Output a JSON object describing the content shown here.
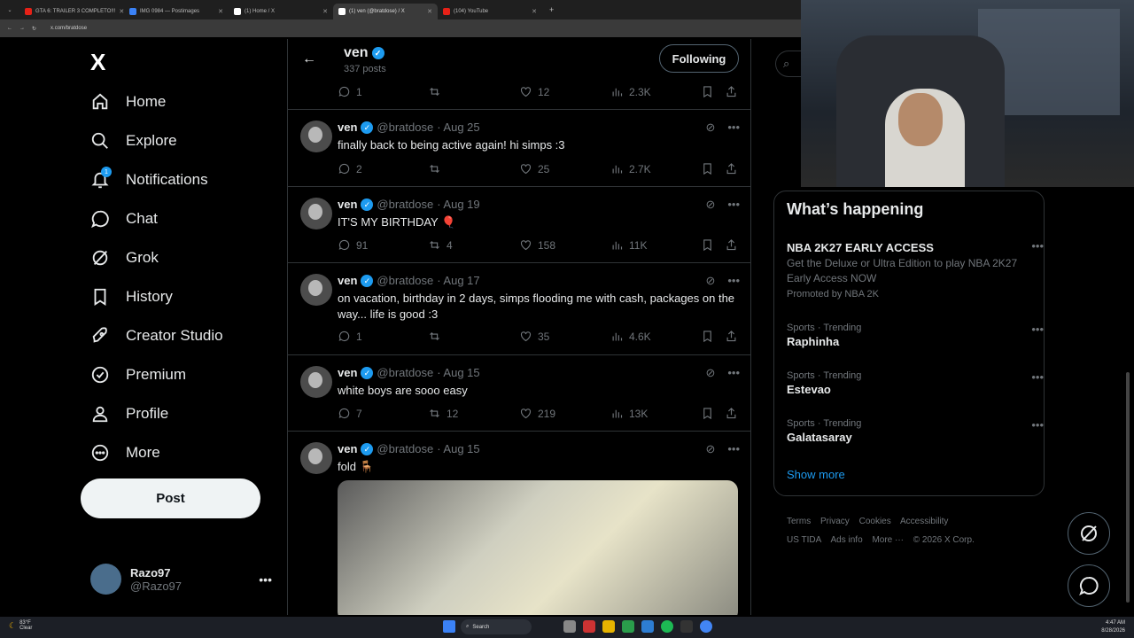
{
  "browser": {
    "tabs": [
      {
        "label": "GTA 6: TRAILER 3 COMPLETO!!!",
        "color": "#e62117",
        "active": false
      },
      {
        "label": "IMG 0984 — Postimages",
        "color": "#3b82f6",
        "active": false
      },
      {
        "label": "(1) Home / X",
        "color": "#ffffff",
        "active": false
      },
      {
        "label": "(1) ven (@bratdose) / X",
        "color": "#ffffff",
        "active": true
      },
      {
        "label": "(104) YouTube",
        "color": "#e62117",
        "active": false
      }
    ],
    "url": "x.com/bratdose"
  },
  "sidebar": {
    "logo": "X",
    "items": [
      {
        "label": "Home",
        "icon": "home-icon"
      },
      {
        "label": "Explore",
        "icon": "search-icon"
      },
      {
        "label": "Notifications",
        "icon": "bell-icon",
        "badge": "1"
      },
      {
        "label": "Chat",
        "icon": "chat-icon"
      },
      {
        "label": "Grok",
        "icon": "grok-icon"
      },
      {
        "label": "History",
        "icon": "bookmark-icon"
      },
      {
        "label": "Creator Studio",
        "icon": "rocket-icon"
      },
      {
        "label": "Premium",
        "icon": "verified-badge-icon"
      },
      {
        "label": "Profile",
        "icon": "person-icon"
      },
      {
        "label": "More",
        "icon": "more-circle-icon"
      }
    ],
    "post_label": "Post",
    "user": {
      "name": "Razo97",
      "handle": "@Razo97"
    }
  },
  "profile_header": {
    "name": "ven",
    "post_count": "337 posts",
    "follow_label": "Following"
  },
  "tweets": [
    {
      "name": "",
      "handle": "",
      "date": "",
      "text": "",
      "replies": "1",
      "reposts": "",
      "likes": "12",
      "views": "2.3K"
    },
    {
      "name": "ven",
      "handle": "@bratdose",
      "date": "· Aug 25",
      "text": "finally back to being active again! hi simps :3",
      "replies": "2",
      "reposts": "",
      "likes": "25",
      "views": "2.7K"
    },
    {
      "name": "ven",
      "handle": "@bratdose",
      "date": "· Aug 19",
      "text": "IT'S MY BIRTHDAY 🎈",
      "replies": "91",
      "reposts": "4",
      "likes": "158",
      "views": "11K"
    },
    {
      "name": "ven",
      "handle": "@bratdose",
      "date": "· Aug 17",
      "text": "on vacation, birthday in 2 days, simps flooding me with cash, packages on the way... life is good :3",
      "replies": "1",
      "reposts": "",
      "likes": "35",
      "views": "4.6K"
    },
    {
      "name": "ven",
      "handle": "@bratdose",
      "date": "· Aug 15",
      "text": "white boys are sooo easy",
      "replies": "7",
      "reposts": "12",
      "likes": "219",
      "views": "13K"
    },
    {
      "name": "ven",
      "handle": "@bratdose",
      "date": "· Aug 15",
      "text": "fold 🪑"
    }
  ],
  "trends": {
    "title": "What’s happening",
    "items": [
      {
        "category": "",
        "name": "NBA 2K27 EARLY ACCESS",
        "description": "Get the Deluxe or Ultra Edition to play NBA 2K27 Early Access NOW",
        "promo": "Promoted by NBA 2K"
      },
      {
        "category": "Sports · Trending",
        "name": "Raphinha"
      },
      {
        "category": "Sports · Trending",
        "name": "Estevao"
      },
      {
        "category": "Sports · Trending",
        "name": "Galatasaray"
      }
    ],
    "show_more": "Show more"
  },
  "footer": {
    "links": [
      "Terms",
      "Privacy",
      "Cookies",
      "Accessibility",
      "US TIDA",
      "Ads info",
      "More ···",
      "© 2026 X Corp."
    ]
  },
  "taskbar": {
    "weather_temp": "83°F",
    "weather_desc": "Clear",
    "search_label": "Search",
    "time": "4:47 AM",
    "date": "8/28/2026"
  }
}
